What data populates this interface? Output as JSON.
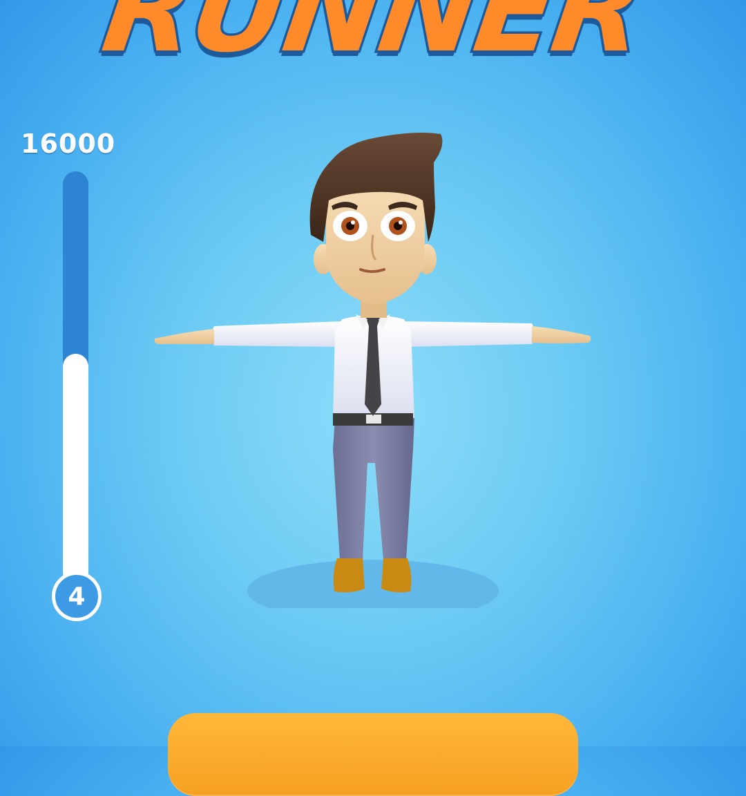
{
  "game": {
    "title": "RUNNER"
  },
  "hud": {
    "score_label": "16000",
    "progress_fraction": 0.56,
    "level": "4"
  },
  "colors": {
    "background_center": "#8ddcf8",
    "background_edge": "#2f8fe6",
    "title_fill": "#ff8a2a",
    "title_outline": "#1d5a9c",
    "progress_track": "#2c84d2",
    "progress_fill": "#ffffff",
    "play_button": "#f6a021"
  },
  "icons": {
    "character": "businessman-character",
    "shadow": "ground-shadow"
  }
}
